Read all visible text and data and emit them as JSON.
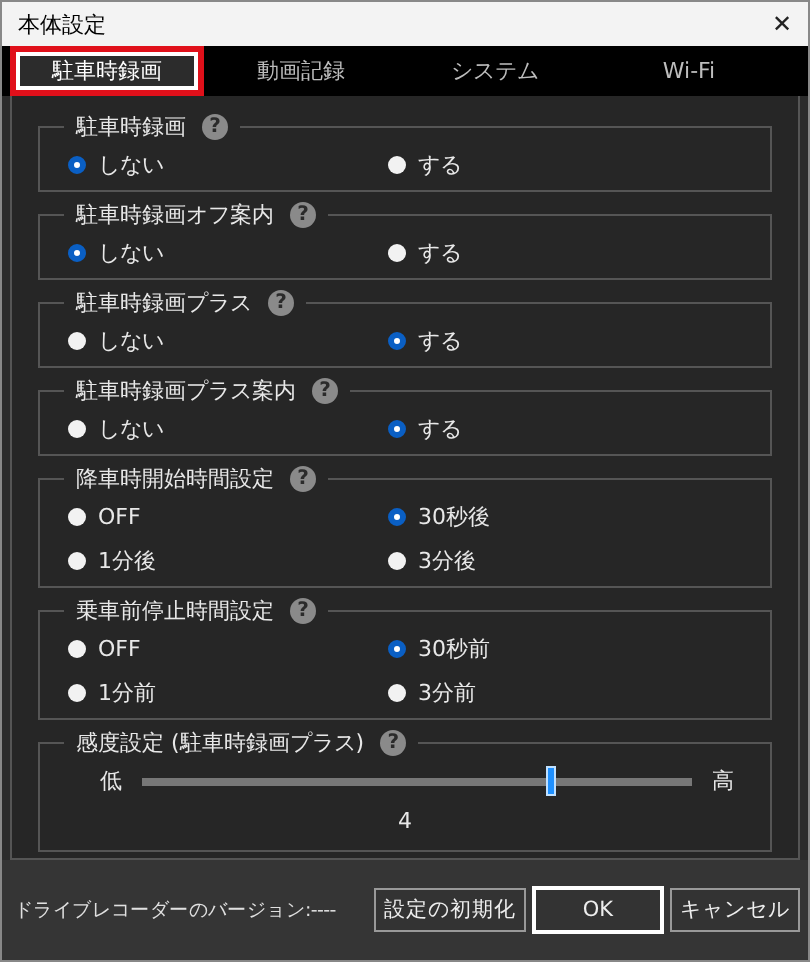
{
  "window": {
    "title": "本体設定",
    "close": "✕"
  },
  "tabs": [
    {
      "label": "駐車時録画",
      "selected": true
    },
    {
      "label": "動画記録",
      "selected": false
    },
    {
      "label": "システム",
      "selected": false
    },
    {
      "label": "Wi-Fi",
      "selected": false
    }
  ],
  "groups": [
    {
      "title": "駐車時録画",
      "help": "?",
      "kind": "radio",
      "options": [
        {
          "label": "しない",
          "selected": true
        },
        {
          "label": "する",
          "selected": false
        }
      ]
    },
    {
      "title": "駐車時録画オフ案内",
      "help": "?",
      "kind": "radio",
      "options": [
        {
          "label": "しない",
          "selected": true
        },
        {
          "label": "する",
          "selected": false
        }
      ]
    },
    {
      "title": "駐車時録画プラス",
      "help": "?",
      "kind": "radio",
      "options": [
        {
          "label": "しない",
          "selected": false
        },
        {
          "label": "する",
          "selected": true
        }
      ]
    },
    {
      "title": "駐車時録画プラス案内",
      "help": "?",
      "kind": "radio",
      "options": [
        {
          "label": "しない",
          "selected": false
        },
        {
          "label": "する",
          "selected": true
        }
      ]
    },
    {
      "title": "降車時開始時間設定",
      "help": "?",
      "kind": "radio",
      "options": [
        {
          "label": "OFF",
          "selected": false
        },
        {
          "label": "30秒後",
          "selected": true
        },
        {
          "label": "1分後",
          "selected": false
        },
        {
          "label": "3分後",
          "selected": false
        }
      ]
    },
    {
      "title": "乗車前停止時間設定",
      "help": "?",
      "kind": "radio",
      "options": [
        {
          "label": "OFF",
          "selected": false
        },
        {
          "label": "30秒前",
          "selected": true
        },
        {
          "label": "1分前",
          "selected": false
        },
        {
          "label": "3分前",
          "selected": false
        }
      ]
    },
    {
      "title": "感度設定 (駐車時録画プラス)",
      "help": "?",
      "kind": "slider",
      "min_label": "低",
      "max_label": "高",
      "level": 0.74,
      "reading": "4"
    }
  ],
  "footer": {
    "version": "ドライブレコーダーのバージョン:----",
    "buttons": [
      {
        "label": "設定の初期化",
        "selected": false
      },
      {
        "label": "OK",
        "selected": true
      },
      {
        "label": "キャンセル",
        "selected": false
      }
    ]
  }
}
